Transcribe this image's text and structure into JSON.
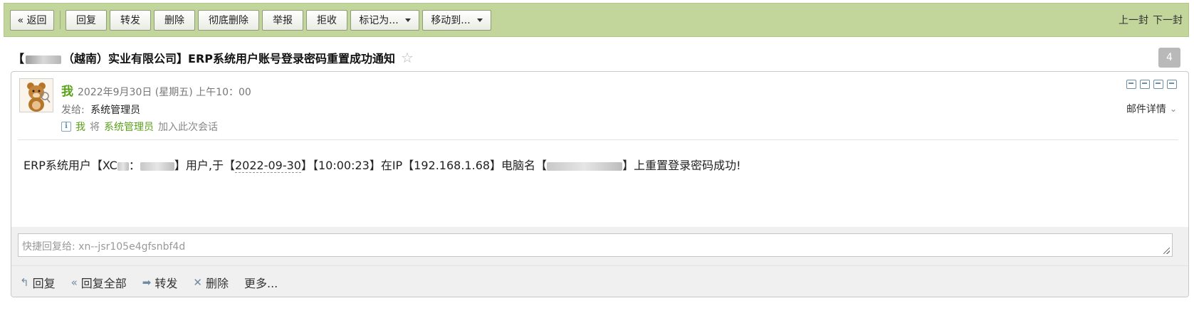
{
  "toolbar": {
    "back": "« 返回",
    "reply": "回复",
    "forward": "转发",
    "delete": "删除",
    "delete_permanently": "彻底删除",
    "report": "举报",
    "reject": "拒收",
    "mark_as": "标记为...",
    "move_to": "移动到...",
    "prev_mail": "上一封",
    "next_mail": "下一封"
  },
  "subject": {
    "prefix": "【",
    "suffix": "（越南）实业有限公司】ERP系统用户账号登录密码重置成功通知",
    "count_badge": "4"
  },
  "mail": {
    "sender": "我",
    "date": "2022年9月30日 (星期五) 上午10：00",
    "to_label": "发给:",
    "to_name": "系统管理员",
    "info_me": "我",
    "info_will": "将",
    "info_contact": "系统管理员",
    "info_join": "加入此次会话",
    "details": "邮件详情",
    "body": {
      "part1": "ERP系统用户【XC",
      "part2": "：",
      "part3": "】用户,于【",
      "date": "2022-09-30",
      "part4": "】【10:00:23】在IP【192.168.1.68】电脑名【",
      "part5": "】上重置登录密码成功!"
    }
  },
  "quick_reply": {
    "placeholder": "快捷回复给: xn--jsr105e4gfsnbf4d"
  },
  "bottom_actions": {
    "reply": "回复",
    "reply_all": "回复全部",
    "forward": "转发",
    "delete": "删除",
    "more": "更多..."
  }
}
